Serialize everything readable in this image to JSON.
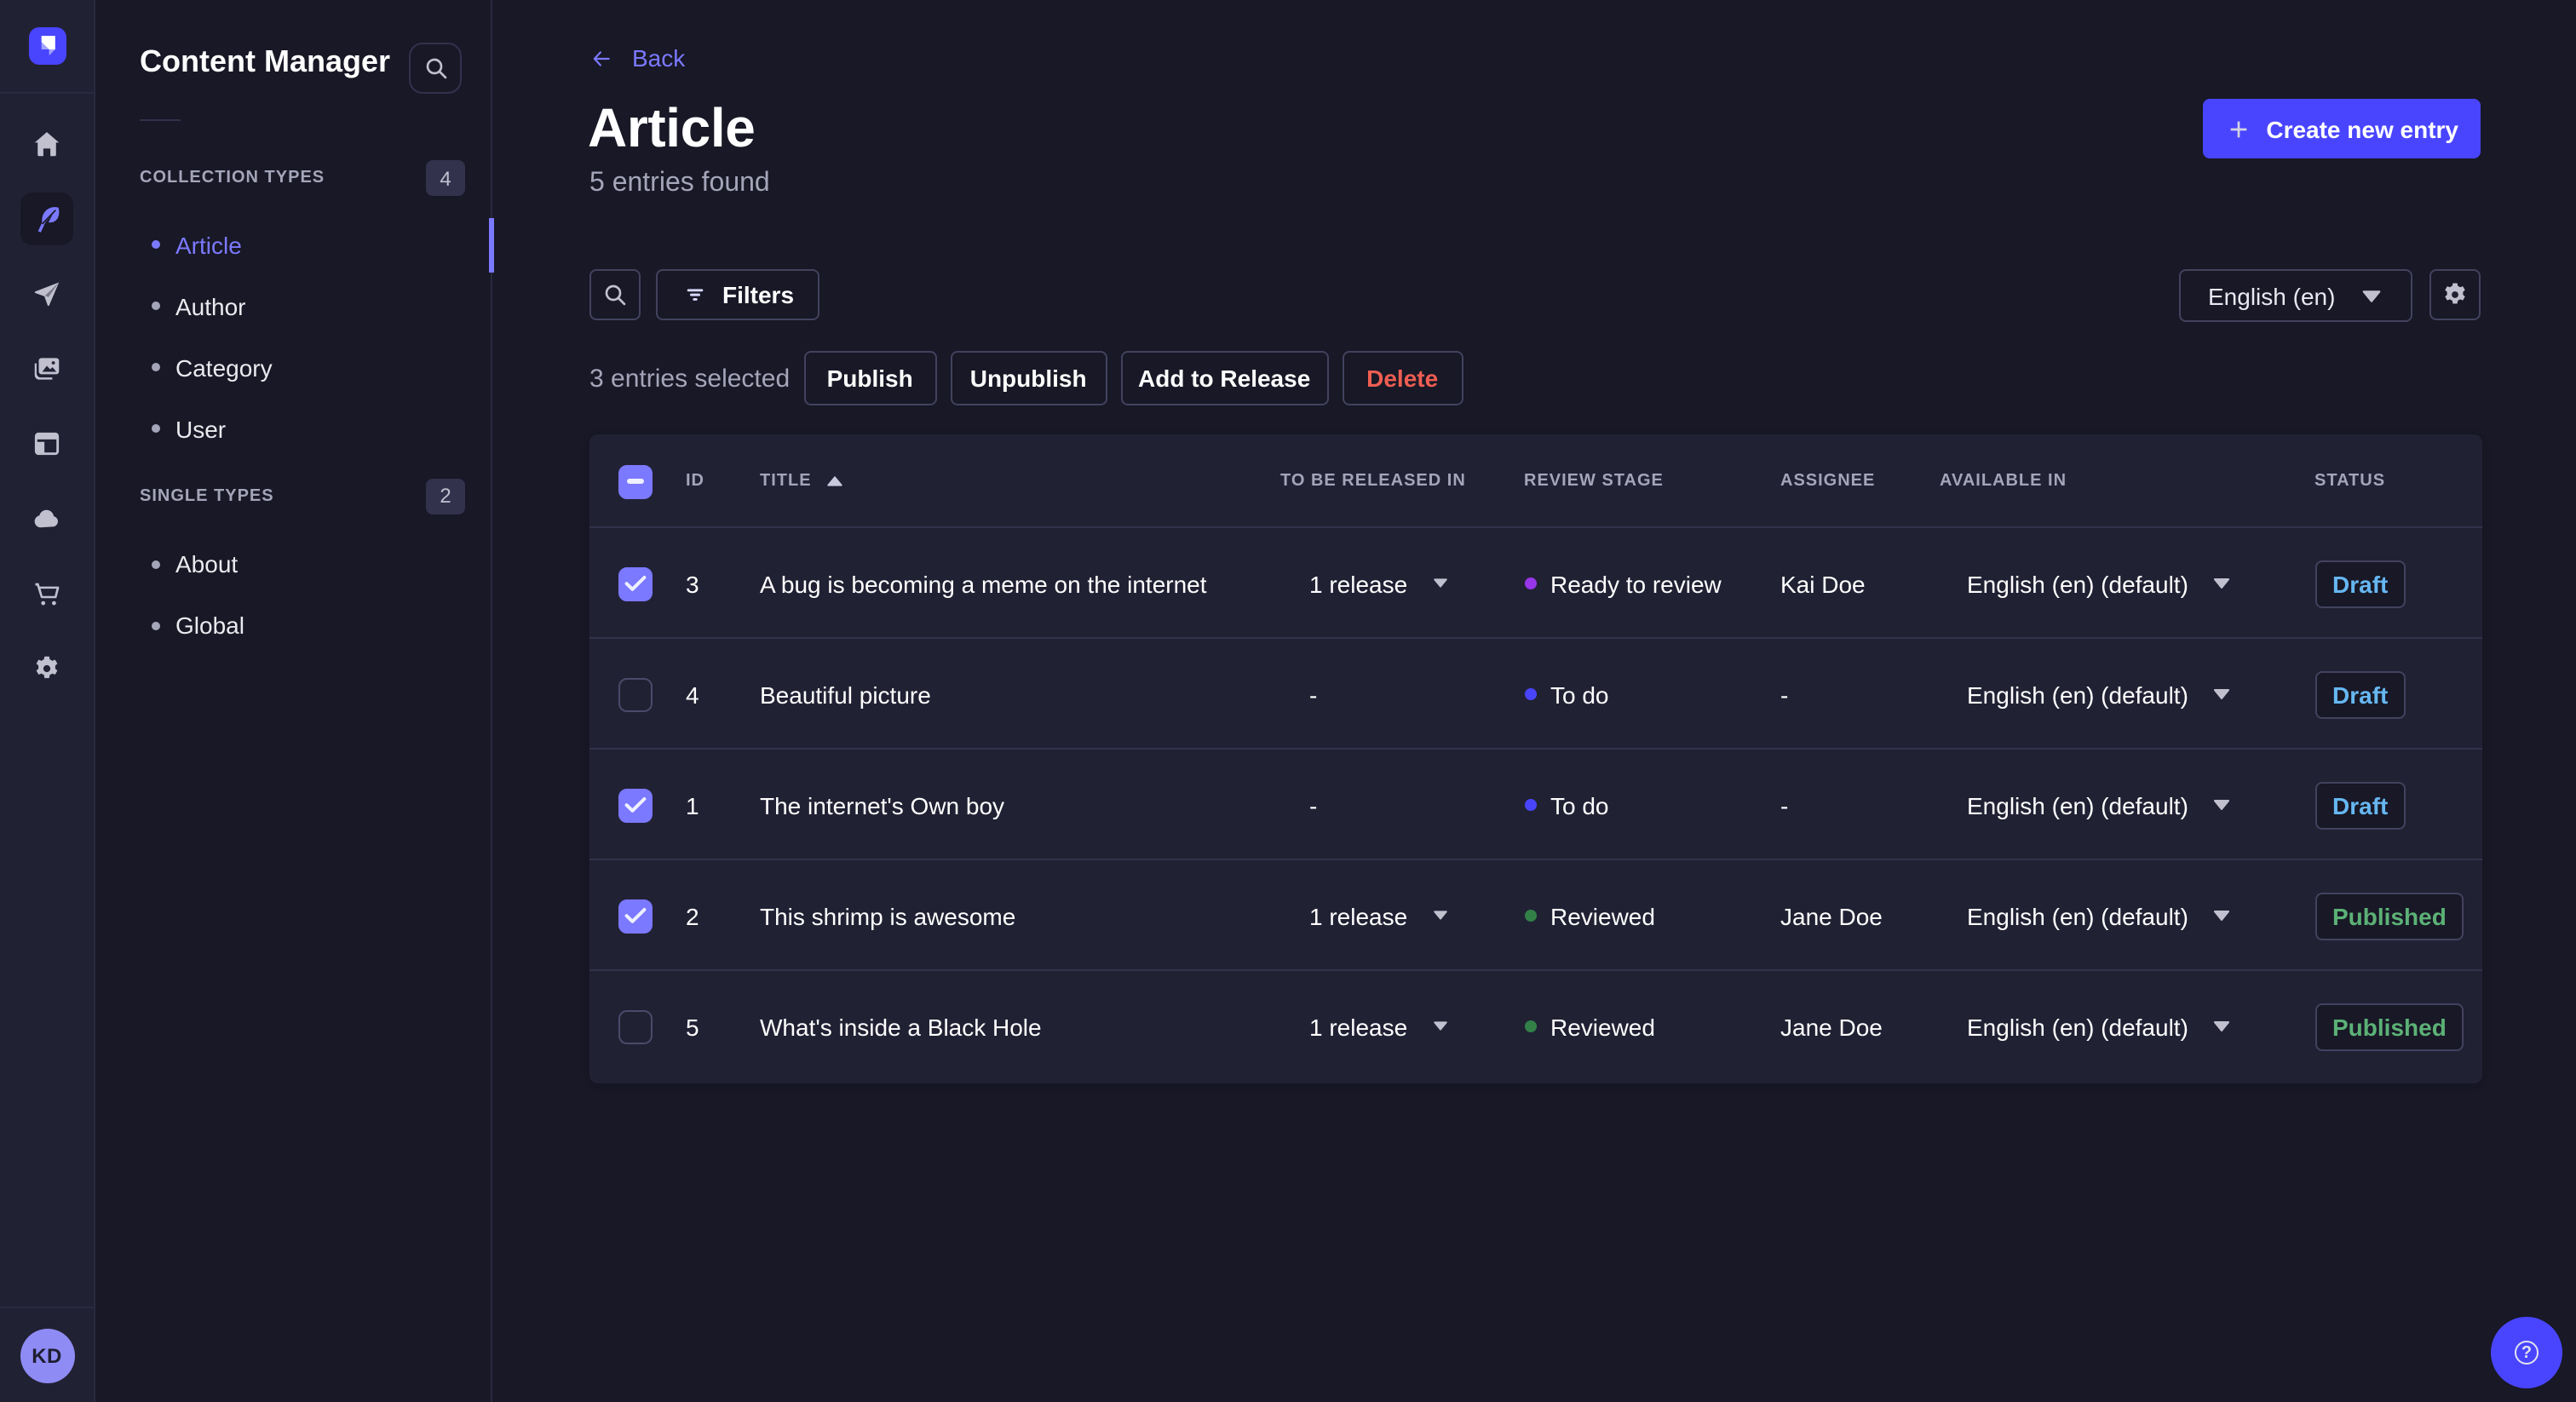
{
  "app": {
    "rail": {
      "icons": [
        {
          "name": "home-icon"
        },
        {
          "name": "content-manager-icon",
          "active": true
        },
        {
          "name": "releases-icon"
        },
        {
          "name": "media-library-icon"
        },
        {
          "name": "content-type-builder-icon"
        },
        {
          "name": "deploy-icon"
        },
        {
          "name": "marketplace-icon"
        },
        {
          "name": "settings-icon"
        }
      ],
      "avatar_initials": "KD"
    }
  },
  "subnav": {
    "title": "Content Manager",
    "sections": [
      {
        "label": "COLLECTION TYPES",
        "badge": "4",
        "items": [
          {
            "label": "Article",
            "active": true
          },
          {
            "label": "Author"
          },
          {
            "label": "Category"
          },
          {
            "label": "User"
          }
        ]
      },
      {
        "label": "SINGLE TYPES",
        "badge": "2",
        "items": [
          {
            "label": "About"
          },
          {
            "label": "Global"
          }
        ]
      }
    ]
  },
  "header": {
    "back_label": "Back",
    "title": "Article",
    "subtitle": "5 entries found",
    "create_button_label": "Create new entry"
  },
  "toolbar": {
    "filters_label": "Filters",
    "locale_value": "English (en)"
  },
  "selection": {
    "text": "3 entries selected",
    "publish_label": "Publish",
    "unpublish_label": "Unpublish",
    "add_to_release_label": "Add to Release",
    "delete_label": "Delete"
  },
  "table": {
    "columns": [
      "ID",
      "TITLE",
      "TO BE RELEASED IN",
      "REVIEW STAGE",
      "ASSIGNEE",
      "AVAILABLE IN",
      "STATUS"
    ],
    "sorted_column": "TITLE",
    "rows": [
      {
        "checked": true,
        "id": "3",
        "title": "A bug is becoming a meme on the internet",
        "release": "1 release",
        "stage": "Ready to review",
        "stage_color": "#9736e8",
        "assignee": "Kai Doe",
        "locale": "English (en) (default)",
        "status": "Draft"
      },
      {
        "checked": false,
        "id": "4",
        "title": "Beautiful picture",
        "release": "-",
        "stage": "To do",
        "stage_color": "#4945ff",
        "assignee": "-",
        "locale": "English (en) (default)",
        "status": "Draft"
      },
      {
        "checked": true,
        "id": "1",
        "title": "The internet's Own boy",
        "release": "-",
        "stage": "To do",
        "stage_color": "#4945ff",
        "assignee": "-",
        "locale": "English (en) (default)",
        "status": "Draft"
      },
      {
        "checked": true,
        "id": "2",
        "title": "This shrimp is awesome",
        "release": "1 release",
        "stage": "Reviewed",
        "stage_color": "#328048",
        "assignee": "Jane Doe",
        "locale": "English (en) (default)",
        "status": "Published"
      },
      {
        "checked": false,
        "id": "5",
        "title": "What's inside a Black Hole",
        "release": "1 release",
        "stage": "Reviewed",
        "stage_color": "#328048",
        "assignee": "Jane Doe",
        "locale": "English (en) (default)",
        "status": "Published"
      }
    ],
    "status_colors": {
      "draft": "#66b7f1",
      "published": "#5cb176"
    }
  },
  "help": {
    "icon": "?"
  },
  "colors": {
    "background": "#181826",
    "panel": "#212134",
    "primary": "#4945ff",
    "primary_light": "#7b79ff",
    "muted_text": "#a5a5ba",
    "danger": "#ee5e52",
    "border": "#32324d"
  }
}
